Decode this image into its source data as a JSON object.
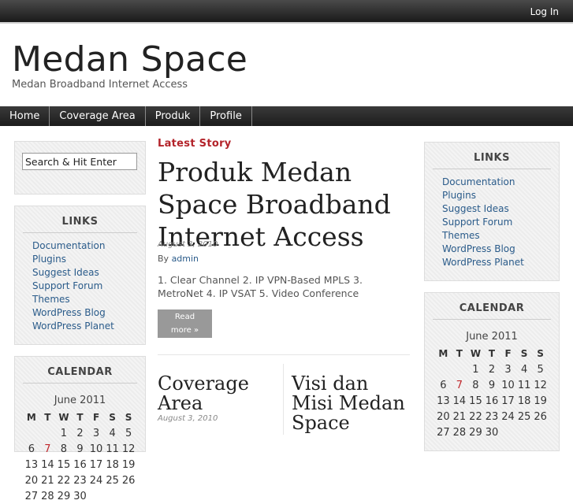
{
  "topbar": {
    "login": "Log In"
  },
  "site": {
    "title": "Medan Space",
    "description": "Medan Broadband Internet Access"
  },
  "nav": [
    "Home",
    "Coverage Area",
    "Produk",
    "Profile"
  ],
  "search": {
    "value": "Search & Hit Enter"
  },
  "links": {
    "title": "LINKS",
    "items": [
      "Documentation",
      "Plugins",
      "Suggest Ideas",
      "Support Forum",
      "Themes",
      "WordPress Blog",
      "WordPress Planet"
    ]
  },
  "calendar": {
    "title": "CALENDAR",
    "caption": "June 2011",
    "headers": [
      "M",
      "T",
      "W",
      "T",
      "F",
      "S",
      "S"
    ],
    "weeks": [
      [
        "",
        "",
        "1",
        "2",
        "3",
        "4",
        "5"
      ],
      [
        "6",
        "7",
        "8",
        "9",
        "10",
        "11",
        "12"
      ],
      [
        "13",
        "14",
        "15",
        "16",
        "17",
        "18",
        "19"
      ],
      [
        "20",
        "21",
        "22",
        "23",
        "24",
        "25",
        "26"
      ],
      [
        "27",
        "28",
        "29",
        "30",
        "",
        "",
        ""
      ]
    ],
    "highlight_day": "7"
  },
  "main": {
    "section_label": "Latest Story",
    "post": {
      "title": "Produk Medan Space Broadband Internet Access",
      "date": "August 3, 2010",
      "by_prefix": "By",
      "author": "admin",
      "excerpt": "1. Clear Channel 2. IP VPN-Based MPLS 3. MetroNet 4. IP VSAT 5. Video Conference",
      "read_more_1": "Read",
      "read_more_2": "more »"
    },
    "sub_posts": [
      {
        "title_1": "Coverage",
        "title_2": "Area",
        "date": "August 3, 2010"
      },
      {
        "title_1": "Visi dan",
        "title_2": "Misi Medan",
        "title_3": "Space"
      }
    ]
  },
  "colors": {
    "accent_red": "#b3232a",
    "link_blue": "#2a5b8a",
    "nav_bg": "#1c1c1c"
  }
}
